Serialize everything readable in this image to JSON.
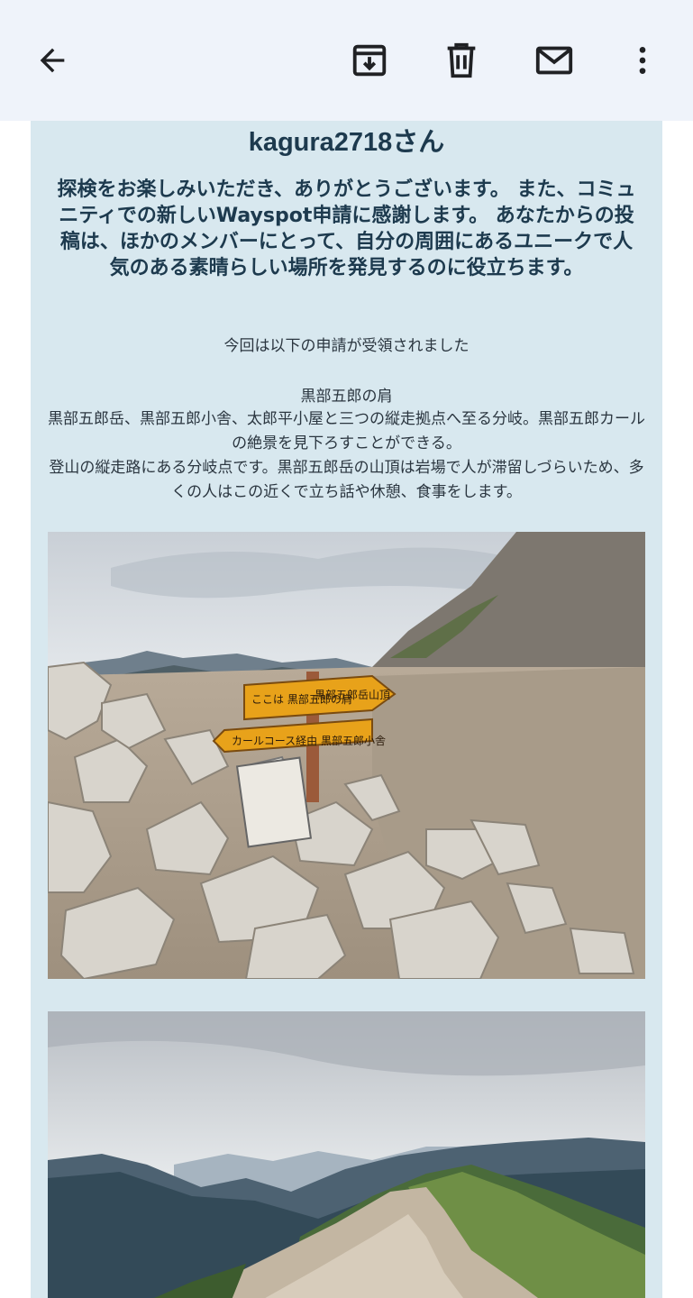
{
  "toolbar": {
    "back_icon": "arrow-left-icon",
    "archive_icon": "archive-icon",
    "delete_icon": "trash-icon",
    "mark_unread_icon": "mail-icon",
    "more_icon": "more-vertical-icon"
  },
  "email": {
    "greeting": "kagura2718さん",
    "thanks": "探検をお楽しみいただき、ありがとうございます。 また、コミュニティでの新しいWayspot申請に感謝します。 あなたからの投稿は、ほかのメンバーにとって、自分の周囲にあるユニークで人気のある素晴らしい場所を発見するのに役立ちます。",
    "accepted_text": "今回は以下の申請が受領されました",
    "spot_title": "黒部五郎の肩",
    "spot_description": "黒部五郎岳、黒部五郎小舎、太郎平小屋と三つの縦走拠点へ至る分岐。黒部五郎カールの絶景を見下ろすことができる。",
    "spot_supplement": "登山の縦走路にある分岐点です。黒部五郎岳の山頂は岩場で人が滞留しづらいため、多くの人はこの近くで立ち話や休憩、食事をします。",
    "sign_text_top_left": "ここは 黒部五郎の肩",
    "sign_text_top_right": "黒部五郎岳山頂",
    "sign_text_bottom": "カールコース経由 黒部五郎小舎"
  },
  "colors": {
    "topbar_bg": "#eff3fa",
    "card_bg": "#d8e8ef",
    "heading_text": "#1d3a4e",
    "body_text": "#2b3640",
    "sign_yellow": "#e8a21a"
  }
}
